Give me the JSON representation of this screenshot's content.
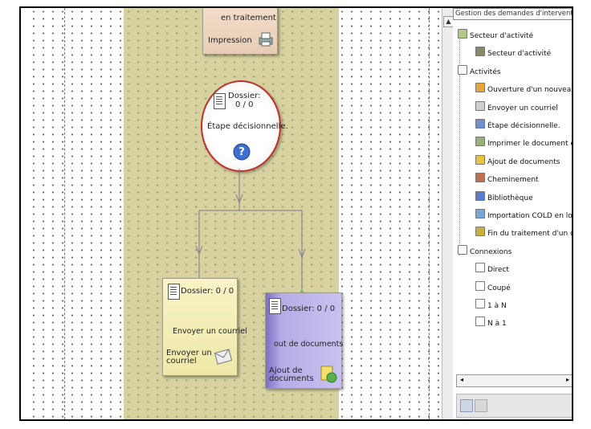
{
  "panel": {
    "title": "Gestion des demandes d'intervention",
    "tree": [
      {
        "label": "Secteur d'activité",
        "level": 0,
        "icon": "folder-icon",
        "color": "#b7c98a"
      },
      {
        "label": "Secteur d'activité",
        "level": 1,
        "icon": "sector-icon",
        "color": "#8a8a6a"
      },
      {
        "label": "Activités",
        "level": 0,
        "icon": "activities-icon",
        "color": "#ffffff"
      },
      {
        "label": "Ouverture d'un nouveau d",
        "level": 1,
        "icon": "open-icon",
        "color": "#e8a33a"
      },
      {
        "label": "Envoyer un courriel",
        "level": 1,
        "icon": "mail-icon",
        "color": "#cfcfcf"
      },
      {
        "label": "Étape décisionnelle.",
        "level": 1,
        "icon": "decision-icon",
        "color": "#6f8fd0"
      },
      {
        "label": "Imprimer le document en",
        "level": 1,
        "icon": "print-icon",
        "color": "#9ab07a"
      },
      {
        "label": "Ajout de documents",
        "level": 1,
        "icon": "add-docs-icon",
        "color": "#e6c640"
      },
      {
        "label": "Cheminement",
        "level": 1,
        "icon": "path-icon",
        "color": "#c07050"
      },
      {
        "label": "Bibliothèque",
        "level": 1,
        "icon": "library-icon",
        "color": "#5a7ad0"
      },
      {
        "label": "Importation COLD en lot",
        "level": 1,
        "icon": "import-icon",
        "color": "#7aa6d8"
      },
      {
        "label": "Fin du traitement d'un do",
        "level": 1,
        "icon": "end-icon",
        "color": "#c8b040"
      },
      {
        "label": "Connexions",
        "level": 0,
        "icon": "connections-icon",
        "color": "#ffffff"
      },
      {
        "label": "Direct",
        "level": 1,
        "icon": "direct-icon",
        "color": "#ffffff"
      },
      {
        "label": "Coupé",
        "level": 1,
        "icon": "cut-icon",
        "color": "#ffffff"
      },
      {
        "label": "1 à N",
        "level": 1,
        "icon": "one-to-n-icon",
        "color": "#ffffff"
      },
      {
        "label": "N à 1",
        "level": 1,
        "icon": "n-to-one-icon",
        "color": "#ffffff"
      }
    ]
  },
  "nodes": {
    "print": {
      "status": "en traitement",
      "label": "Impression"
    },
    "decision": {
      "counter": "Dossier:\n0 / 0",
      "label": "Étape décisionnelle."
    },
    "mail": {
      "counter": "Dossier: 0 / 0",
      "title": "Envoyer un courriel",
      "label": "Envoyer un\ncourriel"
    },
    "docs": {
      "counter": "Dossier: 0 / 0",
      "title": "out de documents",
      "label": "Ajout de\ndocuments"
    }
  },
  "colors": {
    "lane": "#d4cf98",
    "decision_border": "#c0302a",
    "mail_card": "#f3efb8",
    "docs_card": "#b7aee6"
  }
}
